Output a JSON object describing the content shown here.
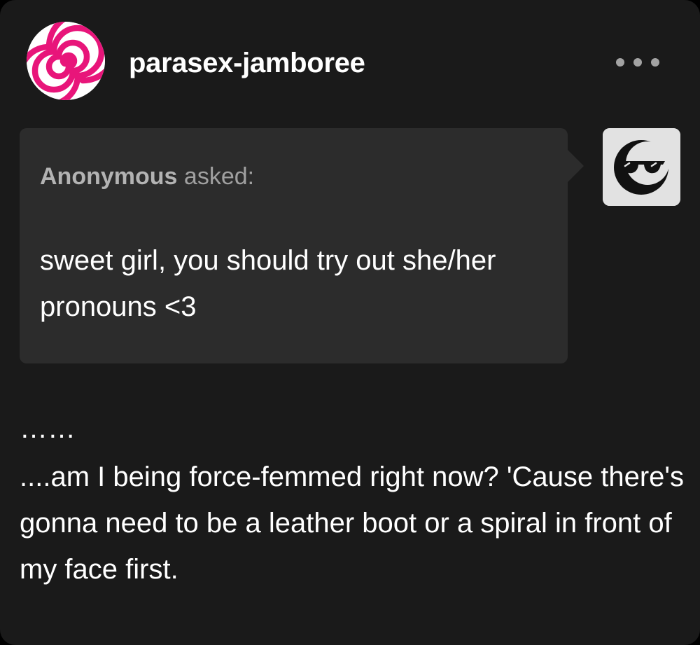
{
  "post": {
    "blog_name": "parasex-jamboree",
    "avatar_icon": "pink-spiral-avatar",
    "more_icon": "ellipsis-icon",
    "ask": {
      "asker": "Anonymous",
      "asked_label": "asked:",
      "question": "sweet girl, you should try out she/her pronouns <3",
      "asker_avatar_icon": "anonymous-sunglasses-avatar"
    },
    "answer": {
      "line1": "……",
      "line2": "....am I being force-femmed right now? 'Cause there's gonna need to be a leather boot or a spiral in front of my face first."
    }
  },
  "colors": {
    "background": "#1a1a1a",
    "ask_bubble": "#2c2c2c",
    "spiral_pink": "#e8157a",
    "text_primary": "#ffffff",
    "text_muted": "#a0a0a0"
  }
}
